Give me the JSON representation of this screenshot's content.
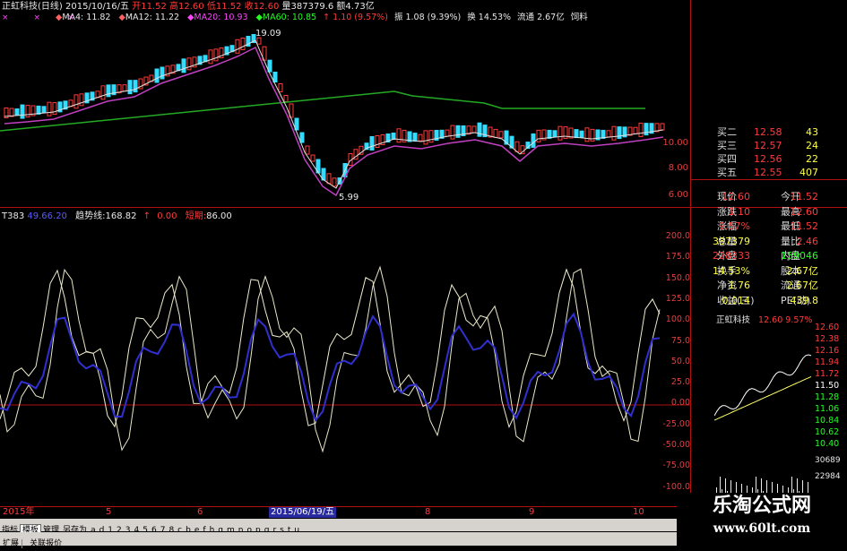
{
  "header": {
    "stock": "正虹科技(日线)",
    "date": "2015/10/16/五",
    "open_label": "开",
    "open": "11.52",
    "high_label": "高",
    "high": "12.60",
    "low_label": "低",
    "low": "11.52",
    "close_label": "收",
    "close": "12.60",
    "vol_label": "量",
    "vol": "387379.6",
    "amt_label": "额",
    "amt": "4.73亿",
    "ma4": "MA4: 11.82",
    "ma12": "MA12: 11.22",
    "ma20": "MA20: 10.93",
    "ma60": "MA60: 10.85",
    "chg": "↑ 1.10 (9.57%)",
    "swing": "振 1.08 (9.39%)",
    "turnover": "换 14.53%",
    "float": "流通 2.67亿",
    "sector": "饲料"
  },
  "price_chart": {
    "high_mark": "19.09",
    "low_mark": "5.99",
    "axis": [
      "10.00",
      "8.00",
      "6.00"
    ]
  },
  "indicator": {
    "name": "T383",
    "v1": "49.66.20",
    "trend_label": "趋势线:",
    "trend": "168.82",
    "arrow": "↑",
    "zero": "0.00",
    "short_label": "短期:",
    "short": "86.00",
    "axis": [
      "200.0",
      "175.0",
      "150.0",
      "125.0",
      "100.0",
      "75.0",
      "50.0",
      "25.0",
      "0.00",
      "-25.00",
      "-50.00",
      "-75.00",
      "-100.0"
    ]
  },
  "xaxis": {
    "labels": [
      "2015年",
      "5",
      "6",
      "2015/06/19/五",
      "8",
      "9",
      "10"
    ]
  },
  "tabs": [
    "指标",
    "模板",
    "管理",
    "另存为",
    "a",
    "d",
    "1",
    "2",
    "3",
    "4",
    "5",
    "6",
    "7",
    "8",
    "c",
    "b",
    "e",
    "f",
    "h",
    "g",
    "m",
    "n",
    "o",
    "p",
    "q",
    "r",
    "s",
    "t",
    "u"
  ],
  "bottom_tabs": [
    "扩展",
    "关联报价"
  ],
  "quotes": {
    "buy": [
      {
        "label": "买二",
        "price": "12.58",
        "vol": "43"
      },
      {
        "label": "买三",
        "price": "12.57",
        "vol": "24"
      },
      {
        "label": "买四",
        "price": "12.56",
        "vol": "22"
      },
      {
        "label": "买五",
        "price": "12.55",
        "vol": "407"
      }
    ],
    "stats": [
      {
        "l1": "现价",
        "v1": "12.60",
        "l2": "今开",
        "v2": "11.52",
        "c1": "red",
        "c2": "red"
      },
      {
        "l1": "涨跌",
        "v1": "1.10",
        "l2": "最高",
        "v2": "12.60",
        "c1": "red",
        "c2": "red"
      },
      {
        "l1": "涨幅",
        "v1": "9.57%",
        "l2": "最低",
        "v2": "11.52",
        "c1": "red",
        "c2": "red"
      },
      {
        "l1": "总量",
        "v1": "387379",
        "l2": "量比",
        "v2": "2.46",
        "c1": "yellow",
        "c2": "red"
      },
      {
        "l1": "外盘",
        "v1": "228333",
        "l2": "内盘",
        "v2": "159046",
        "c1": "red",
        "c2": "green"
      },
      {
        "l1": "换手",
        "v1": "14.53%",
        "l2": "股本",
        "v2": "2.67亿",
        "c1": "yellow",
        "c2": "yellow"
      },
      {
        "l1": "净资",
        "v1": "1.76",
        "l2": "流通",
        "v2": "2.67亿",
        "c1": "yellow",
        "c2": "yellow"
      },
      {
        "l1": "收益(三)",
        "v1": "0.014",
        "l2": "PE(动)",
        "v2": "439.8",
        "c1": "yellow",
        "c2": "yellow"
      }
    ]
  },
  "mini_chart": {
    "title": "正虹科技",
    "price": "12.60",
    "pct": "9.57%",
    "axis": [
      "12.60",
      "12.38",
      "12.16",
      "11.94",
      "11.72",
      "11.50",
      "11.28",
      "11.06",
      "10.84",
      "10.62",
      "10.40"
    ],
    "vol_axis": [
      "30689",
      "22984"
    ]
  },
  "watermark": {
    "title": "乐淘公式网",
    "url": "www.60lt.com"
  },
  "colors": {
    "up": "#ff3b3b",
    "down": "#22ff22",
    "bg": "#000000",
    "grid": "#b01010"
  }
}
